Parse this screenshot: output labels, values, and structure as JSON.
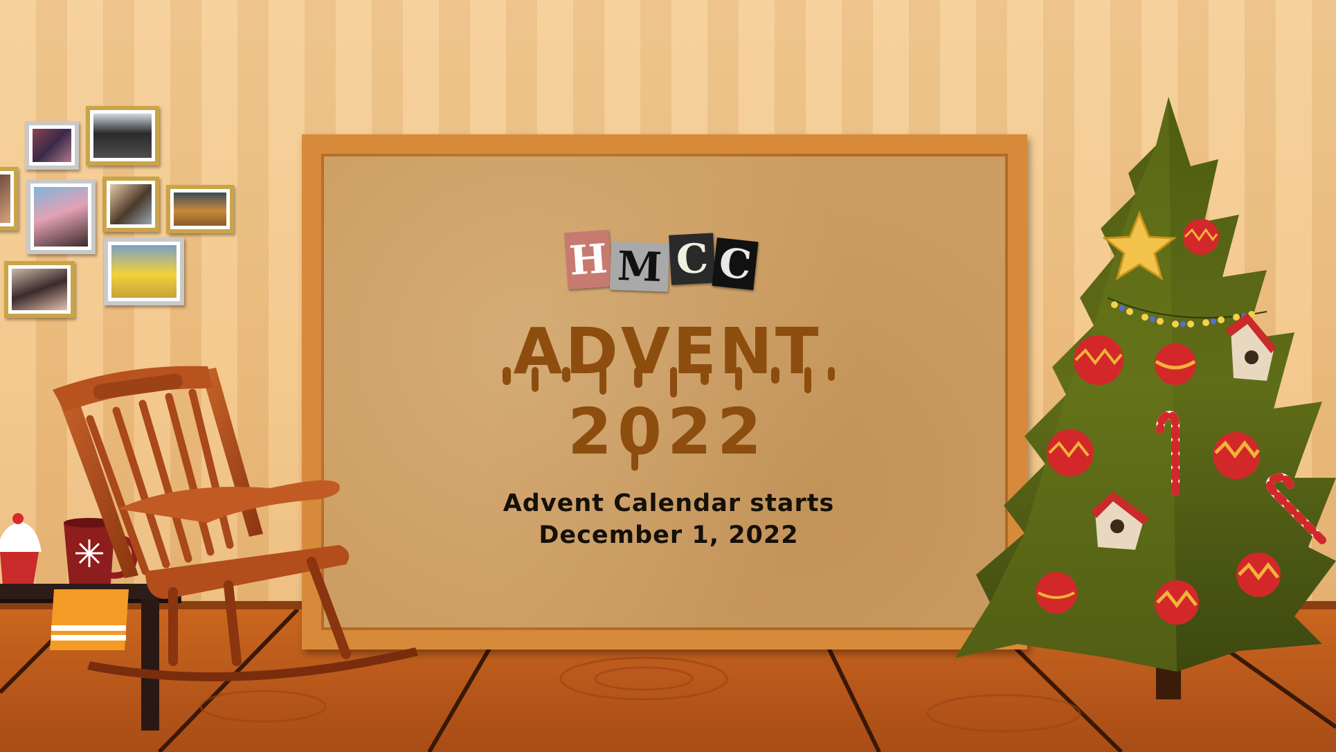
{
  "scene": {
    "logo_letters": [
      "H",
      "M",
      "C",
      "C"
    ],
    "title": "ADVENT",
    "year": "2022",
    "subtitle_line1": "Advent Calendar starts",
    "subtitle_line2": "December 1, 2022"
  },
  "colors": {
    "wall_light": "#f3c98f",
    "wall_dark": "#e8b879",
    "board_cork": "#cc9d62",
    "board_frame": "#d88a3b",
    "title_brown": "#8c4d0e",
    "floor": "#c9661f",
    "tree_green": "#5b6a12"
  },
  "icons": [
    "rocking-chair-icon",
    "christmas-tree-icon",
    "star-icon",
    "ornament-icon",
    "candy-cane-icon",
    "birdhouse-icon",
    "mug-icon",
    "cupcake-icon",
    "photo-frame-icon"
  ]
}
